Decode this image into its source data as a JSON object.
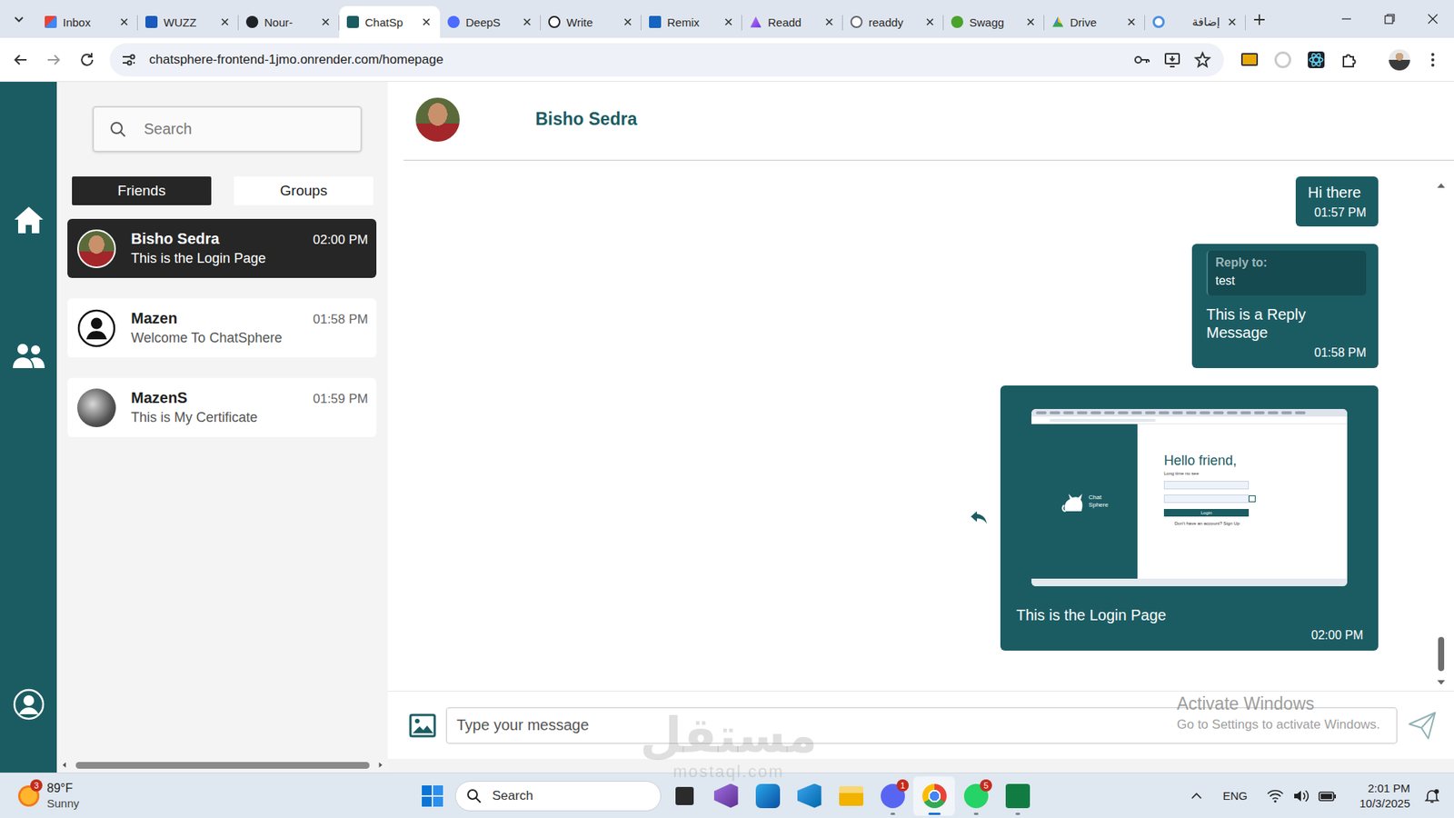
{
  "browser": {
    "tabs": [
      {
        "label": "Inbox",
        "kind": "gmail",
        "selected": false
      },
      {
        "label": "WUZZ",
        "kind": "word",
        "selected": false
      },
      {
        "label": "Nour-",
        "kind": "github",
        "selected": false
      },
      {
        "label": "ChatSp",
        "kind": "chatsphere",
        "selected": true
      },
      {
        "label": "DeepS",
        "kind": "deepseek",
        "selected": false
      },
      {
        "label": "Write",
        "kind": "openai",
        "selected": false
      },
      {
        "label": "Remix",
        "kind": "remix",
        "selected": false
      },
      {
        "label": "Readd",
        "kind": "readdy",
        "selected": false
      },
      {
        "label": "readdy",
        "kind": "globe",
        "selected": false
      },
      {
        "label": "Swagg",
        "kind": "swagger",
        "selected": false
      },
      {
        "label": "Drive",
        "kind": "drive",
        "selected": false
      },
      {
        "label": "إضافة",
        "kind": "extension",
        "selected": false
      }
    ],
    "url": "chatsphere-frontend-1jmo.onrender.com/homepage"
  },
  "sidebar": {
    "search": {
      "placeholder": "Search"
    },
    "filters": [
      {
        "label": "Friends",
        "selected": true
      },
      {
        "label": "Groups",
        "selected": false
      }
    ],
    "chats": [
      {
        "name": "Bisho Sedra",
        "preview": "This is the Login Page",
        "time": "02:00 PM",
        "avatar": "portrait",
        "selected": true
      },
      {
        "name": "Mazen",
        "preview": "Welcome To ChatSphere",
        "time": "01:58 PM",
        "avatar": "placeholder",
        "selected": false
      },
      {
        "name": "MazenS",
        "preview": "This is My Certificate",
        "time": "01:59 PM",
        "avatar": "snapshot",
        "selected": false
      }
    ]
  },
  "chat": {
    "name": "Bisho Sedra",
    "avatar": "portrait",
    "messages": [
      {
        "kind": "text",
        "text": "Hi there",
        "time": "01:57 PM",
        "hovered": false
      },
      {
        "kind": "reply",
        "reply_label": "Reply to:",
        "reply_text": "test",
        "text": "This is a Reply Message",
        "time": "01:58 PM",
        "hovered": false
      },
      {
        "kind": "image",
        "text": "This is the Login Page",
        "time": "02:00 PM",
        "hovered": true,
        "image": {
          "logo": [
            "Chat",
            "Sphere"
          ],
          "heading": "Hello friend,",
          "subheading": "Long time no see",
          "button": "Login",
          "footer": "Don't have an account? Sign Up"
        }
      }
    ]
  },
  "composer": {
    "placeholder": "Type your message"
  },
  "watermarks": {
    "activation_title": "Activate Windows",
    "activation_hint": "Go to Settings to activate Windows.",
    "logo": "مستقل",
    "site": "mostaql.com"
  },
  "taskbar": {
    "weather": {
      "badge": "3",
      "temperature": "89°F",
      "condition": "Sunny"
    },
    "search": "Search",
    "apps": [
      {
        "kind": "files",
        "badge": "",
        "running": false,
        "selected": false
      },
      {
        "kind": "visualstudio",
        "badge": "",
        "running": false,
        "selected": false
      },
      {
        "kind": "outlook",
        "badge": "",
        "running": false,
        "selected": false
      },
      {
        "kind": "vscode",
        "badge": "",
        "running": false,
        "selected": false
      },
      {
        "kind": "explorer",
        "badge": "",
        "running": false,
        "selected": false
      },
      {
        "kind": "discord",
        "badge": "1",
        "running": true,
        "selected": false
      },
      {
        "kind": "chrome",
        "badge": "",
        "running": true,
        "selected": true
      },
      {
        "kind": "whatsapp",
        "badge": "5",
        "running": true,
        "selected": false
      },
      {
        "kind": "excel",
        "badge": "",
        "running": true,
        "selected": false
      }
    ],
    "tray": {
      "language": "ENG",
      "time": "2:01 PM",
      "date": "10/3/2025"
    }
  }
}
